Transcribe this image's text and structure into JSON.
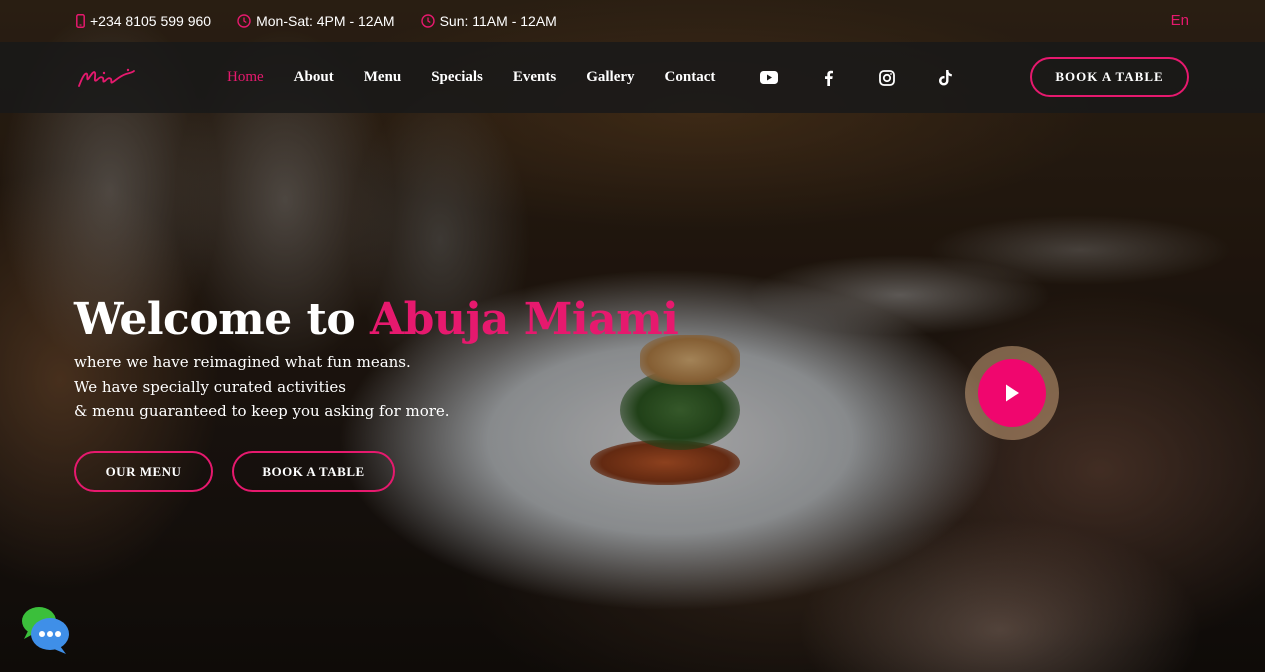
{
  "topbar": {
    "phone": "+234 8105 599 960",
    "hours_weekday": "Mon-Sat: 4PM - 12AM",
    "hours_sunday": "Sun: 11AM - 12AM",
    "language": "En"
  },
  "nav": {
    "items": [
      {
        "label": "Home",
        "active": true
      },
      {
        "label": "About"
      },
      {
        "label": "Menu"
      },
      {
        "label": "Specials"
      },
      {
        "label": "Events"
      },
      {
        "label": "Gallery"
      },
      {
        "label": "Contact"
      }
    ],
    "social": [
      "youtube-icon",
      "facebook-icon",
      "instagram-icon",
      "tiktok-icon"
    ],
    "book_label": "BOOK A TABLE"
  },
  "hero": {
    "title_prefix": "Welcome to",
    "title_accent": "Abuja Miami",
    "line1": "where we have reimagined what fun means.",
    "line2": "We have specially curated activities",
    "line3": "& menu guaranteed to keep you asking for more.",
    "menu_button": "OUR MENU",
    "book_button": "BOOK A TABLE"
  },
  "colors": {
    "accent": "#e6196e",
    "header_bg": "#191919"
  }
}
